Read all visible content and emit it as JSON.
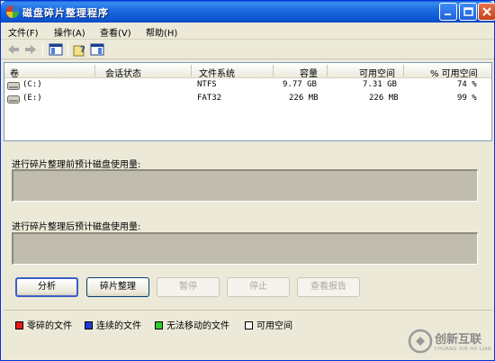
{
  "window": {
    "title": "磁盘碎片整理程序"
  },
  "menu": [
    {
      "label": "文件(F)"
    },
    {
      "label": "操作(A)"
    },
    {
      "label": "查看(V)"
    },
    {
      "label": "帮助(H)"
    }
  ],
  "toolbar": {
    "icons": [
      "back-arrow-icon",
      "forward-arrow-icon",
      "properties-icon",
      "help-icon",
      "console-tree-icon"
    ]
  },
  "volumes": {
    "columns": [
      "卷",
      "会话状态",
      "文件系统",
      "容量",
      "可用空间",
      "% 可用空间"
    ],
    "rows": [
      {
        "volume": "(C:)",
        "session_status": "",
        "file_system": "NTFS",
        "capacity": "9.77 GB",
        "free_space": "7.31 GB",
        "percent_free": "74 %"
      },
      {
        "volume": "(E:)",
        "session_status": "",
        "file_system": "FAT32",
        "capacity": "226 MB",
        "free_space": "226 MB",
        "percent_free": "99 %"
      }
    ]
  },
  "analysis": {
    "before_label": "进行碎片整理前预计磁盘使用量:",
    "after_label": "进行碎片整理后预计磁盘使用量:"
  },
  "buttons": [
    {
      "label": "分析",
      "enabled": true
    },
    {
      "label": "碎片整理",
      "enabled": true
    },
    {
      "label": "暂停",
      "enabled": false
    },
    {
      "label": "停止",
      "enabled": false
    },
    {
      "label": "查看报告",
      "enabled": false
    }
  ],
  "legend": [
    {
      "label": "零碎的文件",
      "color": "#e31b1b"
    },
    {
      "label": "连续的文件",
      "color": "#1d3ccf"
    },
    {
      "label": "无法移动的文件",
      "color": "#2ecb2e"
    },
    {
      "label": "可用空间",
      "color": "#ffffff"
    }
  ],
  "watermark": {
    "text": "创新互联",
    "subtext": "CHUANG XIN HU LIAN"
  }
}
